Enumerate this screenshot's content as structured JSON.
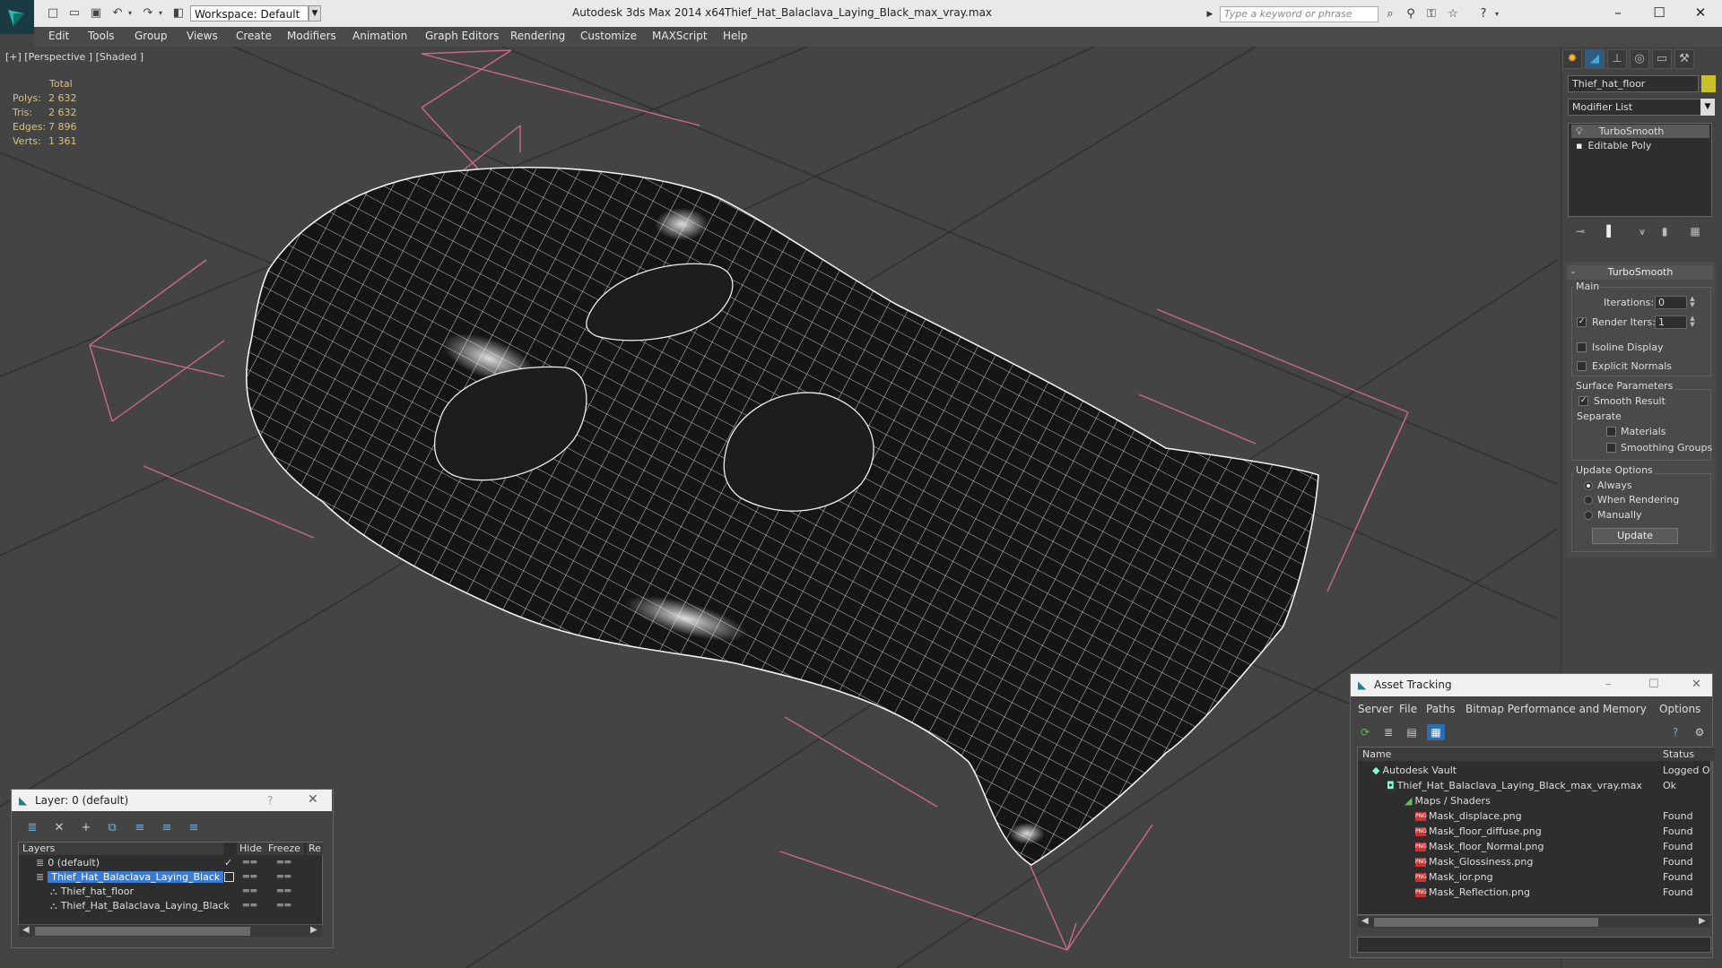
{
  "titlebar": {
    "workspace": "Workspace: Default",
    "app_title": "Autodesk 3ds Max 2014 x64",
    "doc_title": "Thief_Hat_Balaclava_Laying_Black_max_vray.max",
    "search_placeholder": "Type a keyword or phrase"
  },
  "menu": [
    "Edit",
    "Tools",
    "Group",
    "Views",
    "Create",
    "Modifiers",
    "Animation",
    "Graph Editors",
    "Rendering",
    "Customize",
    "MAXScript",
    "Help"
  ],
  "viewport": {
    "label": "[+] [Perspective ] [Shaded ]",
    "stats": {
      "header": "Total",
      "rows": [
        {
          "label": "Polys:",
          "value": "2 632"
        },
        {
          "label": "Tris:",
          "value": "2 632"
        },
        {
          "label": "Edges:",
          "value": "7 896"
        },
        {
          "label": "Verts:",
          "value": "1 361"
        }
      ]
    }
  },
  "command_panel": {
    "object_name": "Thief_hat_floor",
    "object_color": "#c8c12b",
    "modifier_list": "Modifier List",
    "stack": [
      "TurboSmooth",
      "Editable Poly"
    ],
    "rollout_title": "TurboSmooth",
    "main_group": "Main",
    "iterations_label": "Iterations:",
    "iterations_value": "0",
    "render_iters_label": "Render Iters:",
    "render_iters_value": "1",
    "isoline_label": "Isoline Display",
    "explicit_normals_label": "Explicit Normals",
    "surface_group": "Surface Parameters",
    "smooth_result_label": "Smooth Result",
    "separate_label": "Separate",
    "materials_label": "Materials",
    "smoothing_groups_label": "Smoothing Groups",
    "update_group": "Update Options",
    "always_label": "Always",
    "when_rendering_label": "When Rendering",
    "manually_label": "Manually",
    "update_button": "Update"
  },
  "layer_dialog": {
    "title": "Layer: 0 (default)",
    "help": "?",
    "columns": [
      "Layers",
      "Hide",
      "Freeze",
      "Re"
    ],
    "rows": [
      {
        "name": "0 (default)",
        "selected": false
      },
      {
        "name": "Thief_Hat_Balaclava_Laying_Black",
        "selected": true
      },
      {
        "name": "Thief_hat_floor",
        "selected": false
      },
      {
        "name": "Thief_Hat_Balaclava_Laying_Black",
        "selected": false
      }
    ]
  },
  "asset_tracking": {
    "title": "Asset Tracking",
    "menu": [
      "Server",
      "File",
      "Paths",
      "Bitmap Performance and Memory",
      "Options"
    ],
    "columns": [
      "Name",
      "Status"
    ],
    "rows": [
      {
        "name": "Autodesk Vault",
        "status": "Logged O"
      },
      {
        "name": "Thief_Hat_Balaclava_Laying_Black_max_vray.max",
        "status": "Ok"
      },
      {
        "name": "Maps / Shaders",
        "status": ""
      },
      {
        "name": "Mask_displace.png",
        "status": "Found"
      },
      {
        "name": "Mask_floor_diffuse.png",
        "status": "Found"
      },
      {
        "name": "Mask_floor_Normal.png",
        "status": "Found"
      },
      {
        "name": "Mask_Glossiness.png",
        "status": "Found"
      },
      {
        "name": "Mask_ior.png",
        "status": "Found"
      },
      {
        "name": "Mask_Reflection.png",
        "status": "Found"
      }
    ]
  }
}
